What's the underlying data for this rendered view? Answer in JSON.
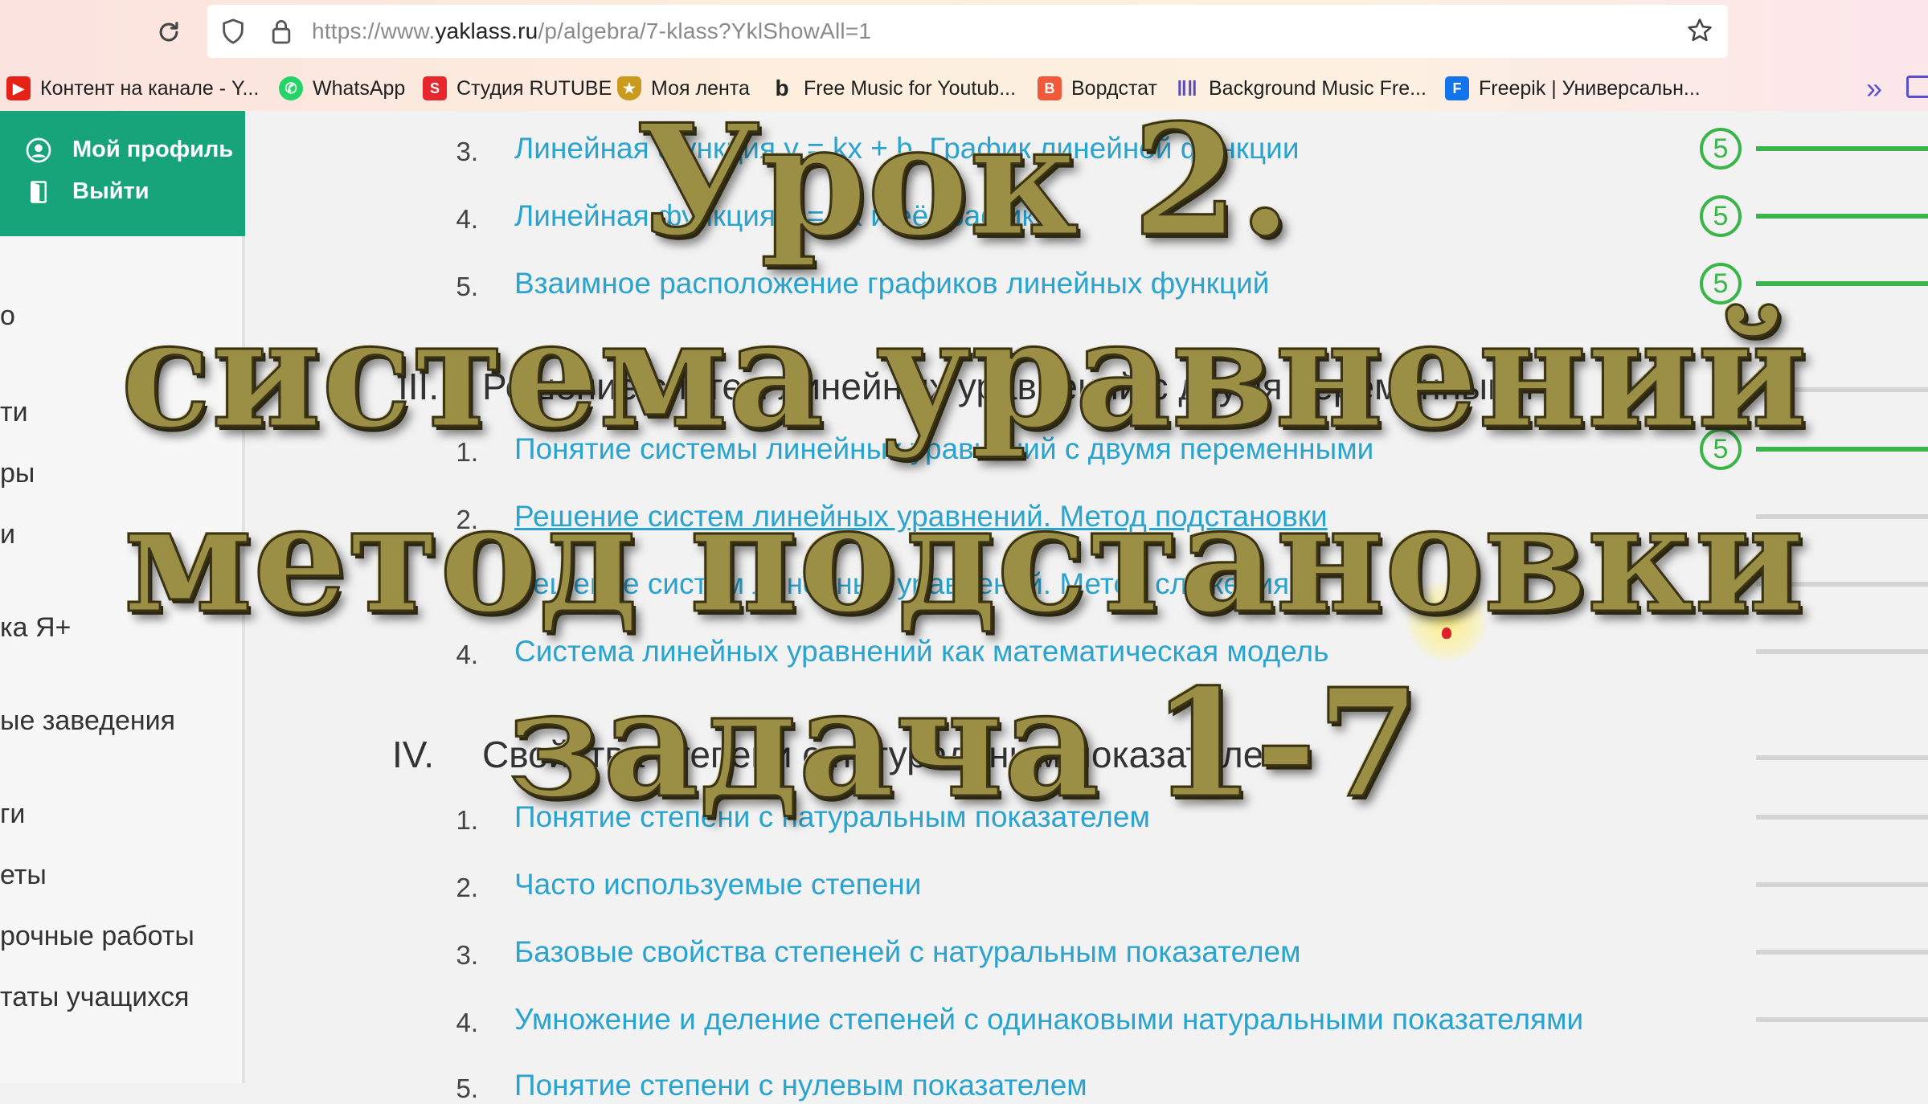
{
  "browser": {
    "url_prefix": "https://www.",
    "url_domain": "yaklass.ru",
    "url_path": "/p/algebra/7-klass?YklShowAll=1",
    "bookmarks": [
      {
        "label": "Контент на канале - Y...",
        "icon": "youtube-icon",
        "color": "#e62117"
      },
      {
        "label": "WhatsApp",
        "icon": "whatsapp-icon",
        "color": "#25d366"
      },
      {
        "label": "Студия RUTUBE",
        "icon": "rutube-icon",
        "color": "#e8262e"
      },
      {
        "label": "Моя лента",
        "icon": "shield-badge-icon",
        "color": "#c99a1c"
      },
      {
        "label": "Free Music for Youtub...",
        "icon": "music-b-icon",
        "color": "#222222"
      },
      {
        "label": "Вордстат",
        "icon": "wordstat-icon",
        "color": "#f2593a"
      },
      {
        "label": "Background Music Fre...",
        "icon": "equalizer-icon",
        "color": "#5b4bb7"
      },
      {
        "label": "Freepik | Универсальн...",
        "icon": "freepik-icon",
        "color": "#1273eb"
      }
    ]
  },
  "sidebar": {
    "profile_label": "Мой профиль",
    "logout_label": "Выйти",
    "items": [
      {
        "label": "о"
      },
      {
        "label": "ти"
      },
      {
        "label": "ры"
      },
      {
        "label": "и"
      },
      {
        "label": "ка Я+"
      },
      {
        "label": "ые заведения"
      },
      {
        "label": "ги"
      },
      {
        "label": "еты"
      },
      {
        "label": "рочные работы"
      },
      {
        "label": "таты учащихся"
      }
    ]
  },
  "content": {
    "rows": [
      {
        "num": "3.",
        "text": "Линейная функция y = kx + b. График линейной функции",
        "score": "5",
        "progress": 1.0
      },
      {
        "num": "4.",
        "text": "Линейная функция y = kx и её график",
        "score": "5",
        "progress": 1.0
      },
      {
        "num": "5.",
        "text": "Взаимное расположение графиков линейных функций",
        "score": "5",
        "progress": 1.0
      }
    ],
    "section3": {
      "num": "III.",
      "title": "Решение систем линейных уравнений с двумя переменными",
      "progress": 0.2
    },
    "rows2": [
      {
        "num": "1.",
        "text": "Понятие системы линейных уравнений с двумя переменными",
        "score": "5",
        "progress": 1.0
      },
      {
        "num": "2.",
        "text": "Решение систем линейных уравнений. Метод подстановки",
        "progress": 0
      },
      {
        "num": "3.",
        "text": "Решение систем линейных уравнений. Метод сложения",
        "progress": 0
      },
      {
        "num": "4.",
        "text": "Система линейных уравнений как математическая модель",
        "progress": 0
      }
    ],
    "section4": {
      "num": "IV.",
      "title": "Свойства степени с натуральным показателем",
      "progress": 0
    },
    "rows3": [
      {
        "num": "1.",
        "text": "Понятие степени с натуральным показателем",
        "progress": 0
      },
      {
        "num": "2.",
        "text": "Часто используемые степени",
        "progress": 0
      },
      {
        "num": "3.",
        "text": "Базовые свойства степеней с натуральным показателем",
        "progress": 0
      },
      {
        "num": "4.",
        "text": "Умножение и деление степеней с одинаковыми натуральными показателями",
        "progress": 0
      },
      {
        "num": "5.",
        "text": "Понятие степени с нулевым показателем",
        "progress": 0
      }
    ]
  },
  "overlay": {
    "line1": "Урок 2.",
    "line2": "система уравнений",
    "line3": "метод подстановки",
    "line4": "задача 1-7"
  }
}
